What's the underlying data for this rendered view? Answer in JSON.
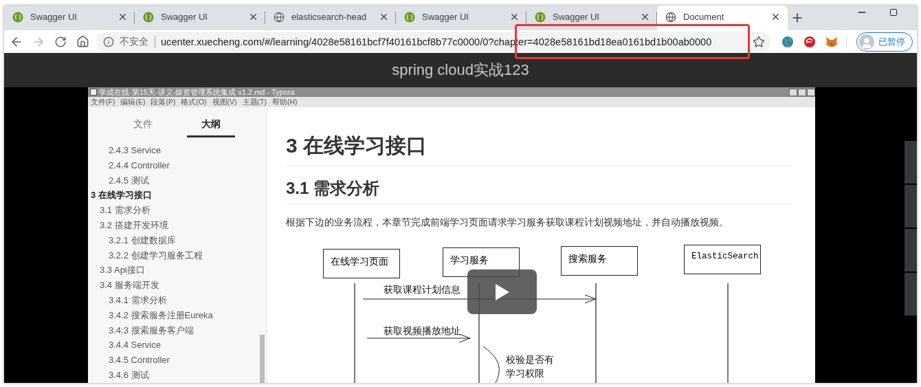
{
  "browser": {
    "tabs": [
      {
        "title": "Swagger UI",
        "kind": "swagger",
        "selected": false
      },
      {
        "title": "Swagger UI",
        "kind": "swagger",
        "selected": false
      },
      {
        "title": "elasticsearch-head",
        "kind": "globe",
        "selected": false
      },
      {
        "title": "Swagger UI",
        "kind": "swagger",
        "selected": false
      },
      {
        "title": "Swagger UI",
        "kind": "swagger",
        "selected": false
      },
      {
        "title": "Document",
        "kind": "globe",
        "selected": true
      }
    ],
    "nav": [
      {
        "kind": "back",
        "disabled": false
      },
      {
        "kind": "forward",
        "disabled": true
      },
      {
        "kind": "reload",
        "disabled": false
      },
      {
        "kind": "home",
        "disabled": false
      }
    ],
    "address": {
      "security": "不安全",
      "url": "ucenter.xuecheng.com/#/learning/4028e58161bcf7f40161bcf8b77c0000/0?chapter=4028e58161bd18ea0161bd1b00ab0000"
    },
    "extensions": [
      {
        "kind": "globe"
      },
      {
        "kind": "red"
      },
      {
        "kind": "fox"
      }
    ],
    "profile": "已暂停"
  },
  "page": {
    "title": "spring cloud实战123",
    "video": {
      "app_title": "学成在线-第15天-讲义-媒资管理系统集成 v1.2.md - Typora",
      "menu": [
        "文件(F)",
        "编辑(E)",
        "段落(P)",
        "格式(O)",
        "视图(V)",
        "主题(T)",
        "帮助(H)"
      ],
      "sidebar_tabs": [
        {
          "label": "文件",
          "selected": false
        },
        {
          "label": "大纲",
          "selected": true
        }
      ],
      "outline": [
        {
          "children": [
            {
              "children": [
                {
                  "label": "2.4.3 Service"
                },
                {
                  "label": "2.4.4 Controller"
                },
                {
                  "label": "2.4.5 测试"
                }
              ]
            }
          ]
        },
        {
          "label": "3 在线学习接口",
          "children": [
            {
              "label": "3.1 需求分析"
            },
            {
              "label": "3.2 搭建开发环境",
              "children": [
                {
                  "label": "3.2.1 创建数据库"
                },
                {
                  "label": "3.2.2 创建学习服务工程"
                }
              ]
            },
            {
              "label": "3.3 Api接口"
            },
            {
              "label": "3.4 服务端开发",
              "children": [
                {
                  "label": "3.4.1 需求分析"
                },
                {
                  "label": "3.4.2 搜索服务注册Eureka"
                },
                {
                  "label": "3.4.3 搜索服务客户端"
                },
                {
                  "label": "3.4.4 Service"
                },
                {
                  "label": "3.4.5 Controller"
                },
                {
                  "label": "3.4.6 测试"
                }
              ]
            }
          ]
        }
      ],
      "heading": "3 在线学习接口",
      "subheading": "3.1 需求分析",
      "paragraph": "根据下边的业务流程，本章节完成前端学习页面请求学习服务获取课程计划视频地址，并自动播放视频。",
      "diagram": {
        "participants": [
          "在线学习页面",
          "学习服务",
          "搜索服务",
          "ElasticSearch"
        ],
        "messages": [
          {
            "label": "获取课程计划信息"
          },
          {
            "label": "获取视频播放地址"
          }
        ],
        "note": [
          "校验是否有",
          "学习权限"
        ]
      }
    }
  }
}
